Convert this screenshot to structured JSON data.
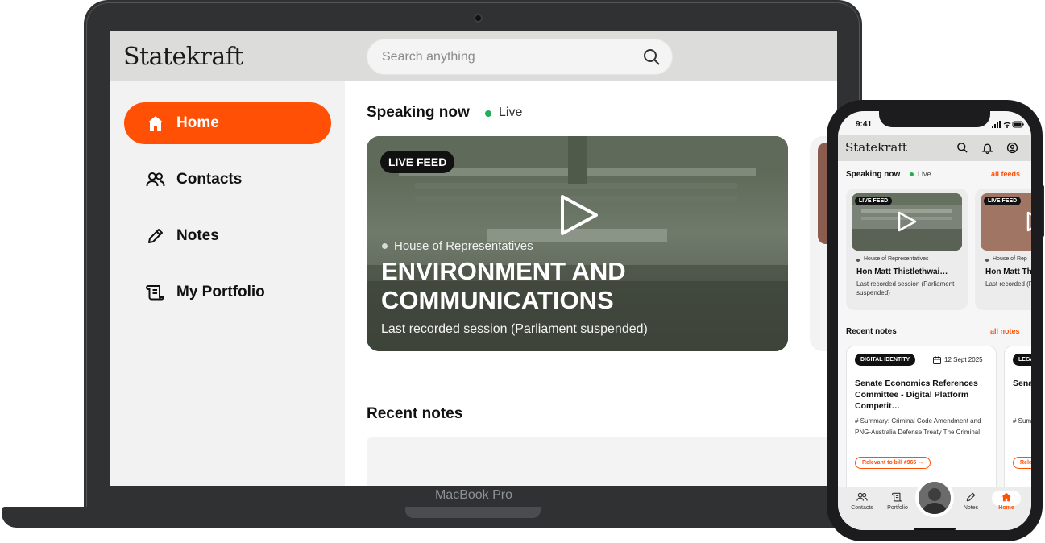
{
  "colors": {
    "accent": "#ff5005",
    "live": "#1fae5b",
    "ink": "#111111",
    "header_bg": "#dcdcdb",
    "sidebar_bg": "#f2f2f2"
  },
  "device_label": "MacBook Pro",
  "web": {
    "logo": "Statekraft",
    "search": {
      "placeholder": "Search anything",
      "icon": "search-icon"
    },
    "sidebar": {
      "items": [
        {
          "label": "Home",
          "icon": "home-icon",
          "active": true
        },
        {
          "label": "Contacts",
          "icon": "contacts-icon",
          "active": false
        },
        {
          "label": "Notes",
          "icon": "pencil-icon",
          "active": false
        },
        {
          "label": "My Portfolio",
          "icon": "scroll-icon",
          "active": false
        }
      ]
    },
    "speaking": {
      "title": "Speaking now",
      "live": "Live",
      "feed": {
        "badge": "LIVE FEED",
        "house": "House of Representatives",
        "title": "ENVIRONMENT AND COMMUNICATIONS",
        "subtitle": "Last recorded session (Parliament suspended)"
      }
    },
    "recent_notes": {
      "title": "Recent notes"
    }
  },
  "mobile": {
    "time": "9:41",
    "logo": "Statekraft",
    "header_icons": [
      "search-icon",
      "bell-icon",
      "profile-icon"
    ],
    "speaking": {
      "title": "Speaking now",
      "live": "Live",
      "link": "all feeds",
      "cards": [
        {
          "badge": "LIVE FEED",
          "house": "House of Representatives",
          "name": "Hon Matt Thistlethwai…",
          "sub": "Last recorded session (Parliament suspended)"
        },
        {
          "badge": "LIVE FEED",
          "house": "House of Rep",
          "name": "Hon Matt Th",
          "sub": "Last recorded (Parliament s"
        }
      ]
    },
    "notes": {
      "title": "Recent notes",
      "link": "all notes",
      "cards": [
        {
          "tag": "DIGITAL IDENTITY",
          "date": "12 Sept 2025",
          "title": "Senate Economics References Committee - Digital Platform Competit…",
          "body": "# Summary: Criminal Code Amendment and PNG-Australia Defense Treaty The Criminal",
          "pill": "Relevant to bill #965 →"
        },
        {
          "tag": "LEGA",
          "title": "Sena Comr Legi",
          "body": "# Sum Amen Defe",
          "pill": "Rele"
        }
      ]
    },
    "tabs": [
      {
        "label": "Contacts",
        "icon": "contacts-icon"
      },
      {
        "label": "Portfolio",
        "icon": "scroll-icon"
      },
      {
        "label": "Notes",
        "icon": "pencil-icon"
      },
      {
        "label": "Home",
        "icon": "home-icon",
        "active": true
      }
    ]
  }
}
